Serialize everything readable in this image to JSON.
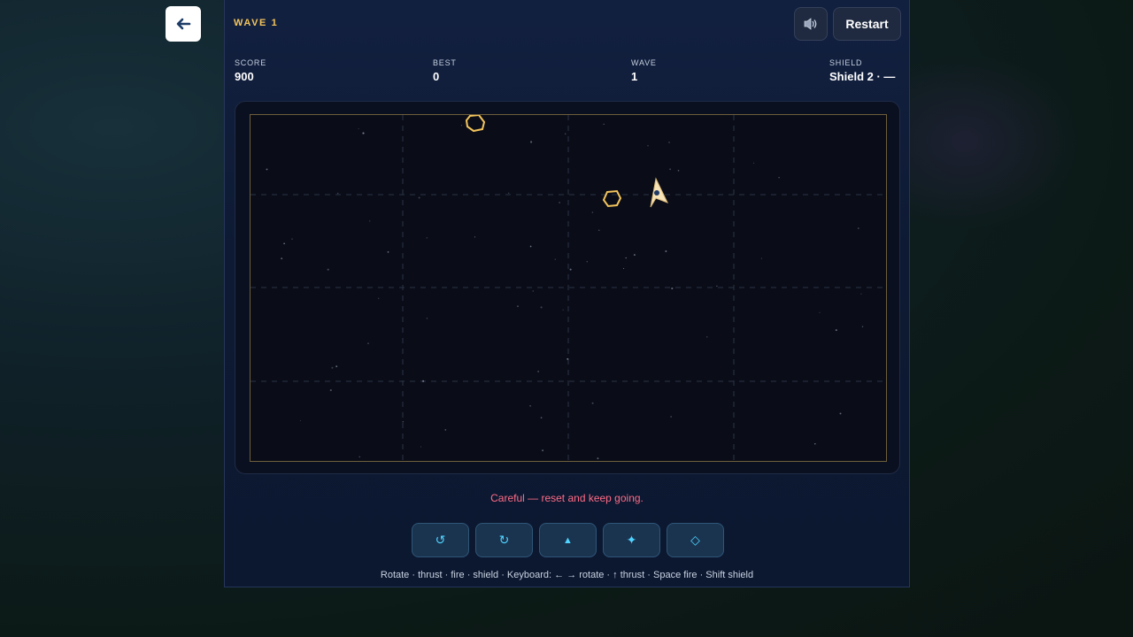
{
  "header": {
    "wave_title": "WAVE 1",
    "restart_label": "Restart",
    "sound_icon": "speaker-muted-icon",
    "back_icon": "arrow-left-icon"
  },
  "stats": {
    "score": {
      "label": "SCORE",
      "value": "900"
    },
    "best": {
      "label": "BEST",
      "value": "0"
    },
    "wave": {
      "label": "WAVE",
      "value": "1"
    },
    "shield": {
      "label": "SHIELD",
      "value": "Shield 2 · —"
    }
  },
  "message": "Careful — reset and keep going.",
  "controls": [
    {
      "name": "rotate-left",
      "icon": "rotate-ccw-icon",
      "glyph": "↺"
    },
    {
      "name": "rotate-right",
      "icon": "rotate-cw-icon",
      "glyph": "↻"
    },
    {
      "name": "thrust",
      "icon": "triangle-up-icon",
      "glyph": "▲"
    },
    {
      "name": "fire",
      "icon": "sparkle-icon",
      "glyph": "✦"
    },
    {
      "name": "shield",
      "icon": "diamond-icon",
      "glyph": "◇"
    }
  ],
  "help_text": "Rotate · thrust · fire · shield · Keyboard: ← → rotate · ↑ thrust · Space fire · Shift shield",
  "colors": {
    "accent": "#f4c55c",
    "warning": "#ff6b86",
    "control_icon": "#4fd3ff",
    "ship": "#f7e3b8"
  }
}
